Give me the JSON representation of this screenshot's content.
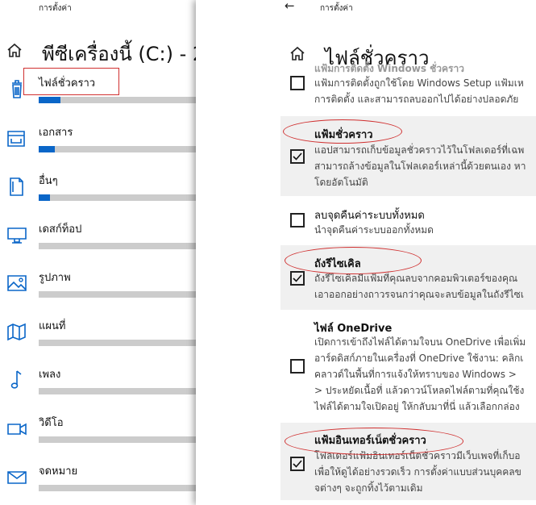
{
  "left_window": {
    "header": "การตั้งค่า",
    "title": "พีซีเครื่องนี้ (C:) - 2",
    "categories": [
      {
        "label": "ไฟล์ชั่วคราว",
        "icon": "trash-icon",
        "usage": 0.14
      },
      {
        "label": "เอกสาร",
        "icon": "documents-icon",
        "usage": 0.1
      },
      {
        "label": "อื่นๆ",
        "icon": "other-files-icon",
        "usage": 0.07
      },
      {
        "label": "เดสก์ท็อป",
        "icon": "desktop-icon",
        "usage": 0
      },
      {
        "label": "รูปภาพ",
        "icon": "pictures-icon",
        "usage": 0
      },
      {
        "label": "แผนที่",
        "icon": "map-icon",
        "usage": 0
      },
      {
        "label": "เพลง",
        "icon": "music-icon",
        "usage": 0
      },
      {
        "label": "วิดีโอ",
        "icon": "video-icon",
        "usage": 0
      },
      {
        "label": "จดหมาย",
        "icon": "mail-icon",
        "usage": 0
      }
    ]
  },
  "right_window": {
    "header": "การตั้งค่า",
    "title": "ไฟล์ชั่วคราว",
    "options": [
      {
        "title": "แฟ้มการติดตั้ง Windows ชั่วคราว",
        "checked": false,
        "desc": [
          "แฟ้มการติดตั้งถูกใช้โดย Windows Setup แฟ้มเห",
          "การติดตั้ง และสามารถลบออกไปได้อย่างปลอดภัย"
        ]
      },
      {
        "title": "แฟ้มชั่วคราว",
        "checked": true,
        "desc": [
          "แอปสามารถเก็บข้อมูลชั่วคราวไว้ในโฟลเดอร์ที่เฉพ",
          "สามารถล้างข้อมูลในโฟลเดอร์เหล่านี้ด้วยตนเอง หา",
          "โดยอัตโนมัติ"
        ]
      },
      {
        "title": "ลบจุดคืนค่าระบบทั้งหมด",
        "checked": false,
        "desc": [
          "นำจุดคืนค่าระบบออกทั้งหมด"
        ]
      },
      {
        "title": "ถังรีไซเคิล",
        "checked": true,
        "desc": [
          "ถังรีไซเคิลมีแฟ้มที่คุณลบจากคอมพิวเตอร์ของคุณ",
          "เอาออกอย่างถาวรจนกว่าคุณจะลบข้อมูลในถังรีไซเ"
        ]
      },
      {
        "title": "ไฟล์ OneDrive",
        "checked": false,
        "desc": [
          "เปิดการเข้าถึงไฟล์ได้ตามใจบน OneDrive เพื่อเพิ่ม",
          "อาร์ดดิสก์ภายในเครื่องที่ OneDrive ใช้งาน: คลิกเ",
          "คลาวด์ในพื้นที่การแจ้งให้ทราบของ Windows >",
          "> ประหยัดเนื้อที่ แล้วดาวน์โหลดไฟล์ตามที่คุณใช้ง",
          "ไฟล์ได้ตามใจเปิดอยู่ ให้กลับมาที่นี่ แล้วเลือกกล่อง"
        ]
      },
      {
        "title": "แฟ้มอินเทอร์เน็ตชั่วคราว",
        "checked": true,
        "desc": [
          "โฟลเดอร์แฟ้มอินเทอร์เน็ตชั่วคราวมีเว็บเพจที่เก็บอ",
          "เพื่อให้ดูได้อย่างรวดเร็ว การตั้งค่าแบบส่วนบุคคลข",
          "จต่างๆ จะถูกทิ้งไว้ตามเดิม"
        ]
      }
    ]
  },
  "colors": {
    "accent": "#0a66c8",
    "annotation": "#d03030",
    "shaded_row": "#f0f0f0"
  }
}
